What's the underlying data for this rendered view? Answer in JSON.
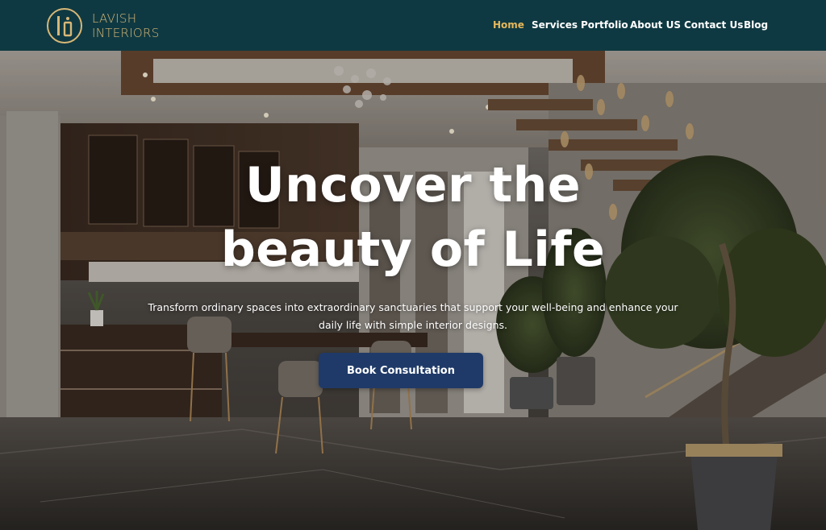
{
  "brand": {
    "line1": "LAVISH",
    "line2": "INTERIORS",
    "logo_icon": "monogram-li-icon",
    "gold": "#d8b877"
  },
  "nav": {
    "items": [
      {
        "label": "Home",
        "active": true
      },
      {
        "label": "Services",
        "active": false
      },
      {
        "label": "Portfolio",
        "active": false
      },
      {
        "label": "About US",
        "active": false
      },
      {
        "label": "Contact Us",
        "active": false
      },
      {
        "label": "Blog",
        "active": false
      }
    ],
    "active_color": "#e6b85c",
    "background": "#0f3942"
  },
  "hero": {
    "headline_line1": "Uncover the",
    "headline_line2": "beauty of Life",
    "subtitle": "Transform ordinary spaces into extraordinary sanctuaries that support your well-being and enhance your daily life with simple interior designs.",
    "cta_label": "Book Consultation",
    "cta_color": "#1f3a68"
  }
}
